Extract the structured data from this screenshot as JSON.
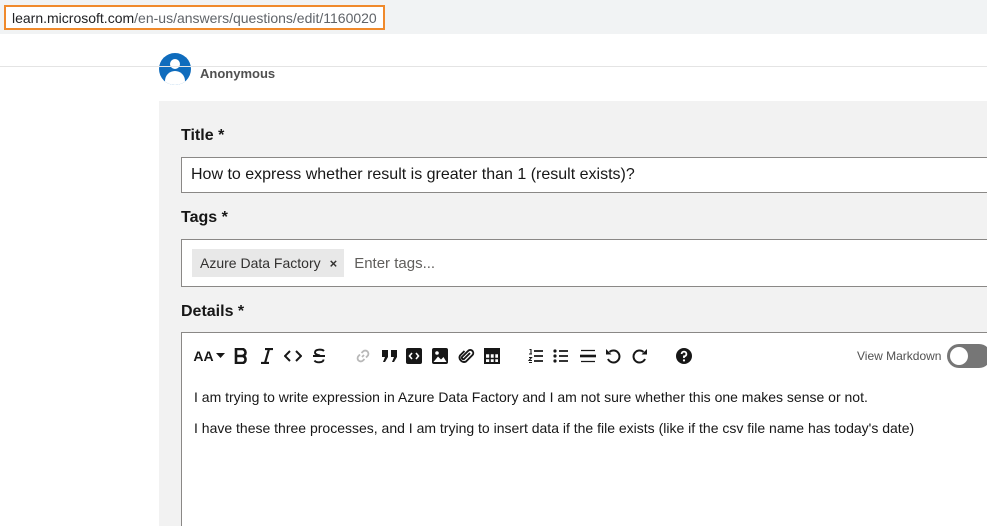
{
  "browser": {
    "url_host": "learn.microsoft.com",
    "url_path": "/en-us/answers/questions/edit/1160020",
    "highlight_color": "#f08a2c"
  },
  "author": {
    "name": "Anonymous",
    "avatar_color": "#0f6cbd"
  },
  "form": {
    "title_label": "Title",
    "title_required": "*",
    "title_value": "How to express whether result is greater than 1 (result exists)?",
    "tags_label": "Tags",
    "tags_required": "*",
    "tags": [
      {
        "label": "Azure Data Factory",
        "remove_icon": "×"
      }
    ],
    "tags_placeholder": "Enter tags...",
    "details_label": "Details",
    "details_required": "*"
  },
  "editor": {
    "toolbar": {
      "font_size_label": "AA",
      "tools": [
        "font-size",
        "bold",
        "italic",
        "code",
        "strikethrough",
        "link",
        "quote",
        "code-block",
        "image",
        "attachment",
        "table",
        "numbered-list",
        "bulleted-list",
        "horizontal-rule",
        "undo",
        "redo",
        "help"
      ]
    },
    "view_markdown_label": "View Markdown",
    "view_markdown_on": false,
    "paragraphs": [
      "I am trying to write expression in Azure Data Factory and I am not sure whether this one makes sense or not.",
      "I have these three processes, and I am trying to insert data if the file exists (like if the csv file name has today's date)"
    ]
  }
}
